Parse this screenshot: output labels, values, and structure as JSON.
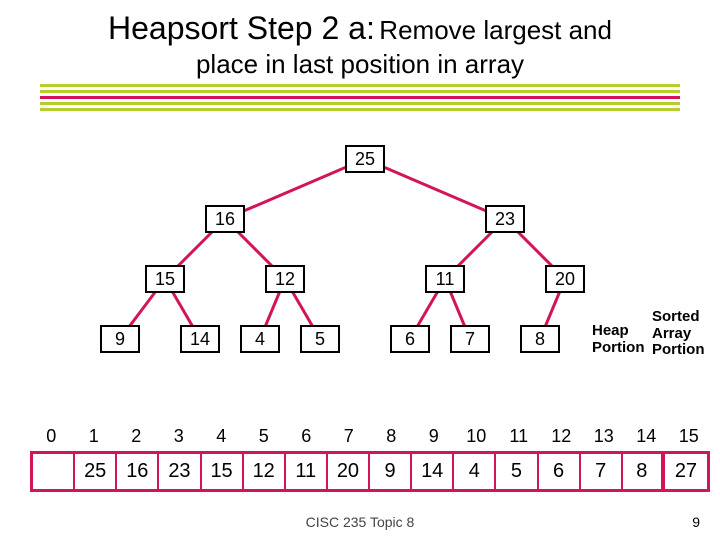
{
  "title": {
    "main": "Heapsort Step 2 a:",
    "sub": "Remove largest and",
    "line2": "place in last position in array"
  },
  "tree": {
    "nodes": {
      "n0": "25",
      "n1": "16",
      "n2": "23",
      "n3": "15",
      "n4": "12",
      "n5": "11",
      "n6": "20",
      "n7": "9",
      "n8": "14",
      "n9": "4",
      "n10": "5",
      "n11": "6",
      "n12": "7",
      "n13": "8"
    }
  },
  "legend": {
    "heap_l1": "Heap",
    "heap_l2": "Portion",
    "sorted_l1": "Sorted",
    "sorted_l2": "Array",
    "sorted_l3": "Portion"
  },
  "indices": [
    "0",
    "1",
    "2",
    "3",
    "4",
    "5",
    "6",
    "7",
    "8",
    "9",
    "10",
    "11",
    "12",
    "13",
    "14",
    "15"
  ],
  "array": [
    "25",
    "16",
    "23",
    "15",
    "12",
    "11",
    "20",
    "9",
    "14",
    "4",
    "5",
    "6",
    "7",
    "8",
    "27"
  ],
  "footer": "CISC 235 Topic 8",
  "page": "9",
  "chart_data": {
    "type": "table",
    "title": "Heapsort Step 2a — heap tree and backing array",
    "tree_edges": [
      [
        0,
        1
      ],
      [
        0,
        2
      ],
      [
        1,
        3
      ],
      [
        1,
        4
      ],
      [
        2,
        5
      ],
      [
        2,
        6
      ],
      [
        3,
        7
      ],
      [
        3,
        8
      ],
      [
        4,
        9
      ],
      [
        4,
        10
      ],
      [
        5,
        11
      ],
      [
        5,
        12
      ],
      [
        6,
        13
      ]
    ],
    "tree_values_by_index": {
      "0": 25,
      "1": 16,
      "2": 23,
      "3": 15,
      "4": 12,
      "5": 11,
      "6": 20,
      "7": 9,
      "8": 14,
      "9": 4,
      "10": 5,
      "11": 6,
      "12": 7,
      "13": 8
    },
    "array_indices": [
      0,
      1,
      2,
      3,
      4,
      5,
      6,
      7,
      8,
      9,
      10,
      11,
      12,
      13,
      14,
      15
    ],
    "array_values": [
      null,
      25,
      16,
      23,
      15,
      12,
      11,
      20,
      9,
      14,
      4,
      5,
      6,
      7,
      8,
      27
    ],
    "heap_portion_range": [
      1,
      14
    ],
    "sorted_portion_range": [
      15,
      15
    ]
  }
}
